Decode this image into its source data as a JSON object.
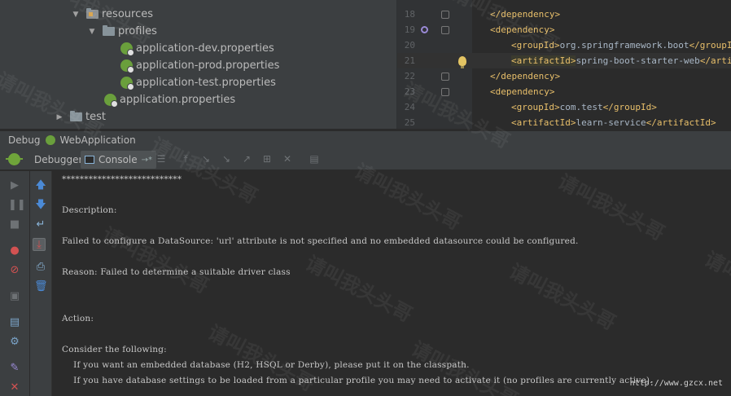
{
  "tree": {
    "items": [
      {
        "label": "resources",
        "arrow": "▼",
        "kind": "resfolder"
      },
      {
        "label": "profiles",
        "arrow": "▼",
        "kind": "folder"
      },
      {
        "label": "application-dev.properties",
        "kind": "spring"
      },
      {
        "label": "application-prod.properties",
        "kind": "spring"
      },
      {
        "label": "application-test.properties",
        "kind": "spring"
      },
      {
        "label": "application.properties",
        "kind": "spring"
      },
      {
        "label": "test",
        "arrow": "▶",
        "kind": "folder"
      }
    ]
  },
  "editor": {
    "lines": [
      {
        "num": "18",
        "text": "</dependency>"
      },
      {
        "num": "19",
        "text": "<dependency>"
      },
      {
        "num": "20",
        "open": "<groupId>",
        "value": "org.springframework.boot",
        "close": "</groupId>"
      },
      {
        "num": "21",
        "open": "<artifactId>",
        "value": "spring-boot-starter-web",
        "close": "</artifact"
      },
      {
        "num": "22",
        "text": "</dependency>"
      },
      {
        "num": "23",
        "text": "<dependency>"
      },
      {
        "num": "24",
        "open": "<groupId>",
        "value": "com.test",
        "close": "</groupId>"
      },
      {
        "num": "25",
        "open": "<artifactId>",
        "value": "learn-service",
        "close": "</artifactId>"
      }
    ]
  },
  "debug": {
    "label": "Debug",
    "config": "WebApplication",
    "tabs": [
      "Debugger",
      "Console"
    ],
    "pin": "→*"
  },
  "console": {
    "lines": [
      "***************************",
      "",
      "Description:",
      "",
      "Failed to configure a DataSource: 'url' attribute is not specified and no embedded datasource could be configured.",
      "",
      "Reason: Failed to determine a suitable driver class",
      "",
      "",
      "Action:",
      "",
      "Consider the following:",
      "    If you want an embedded database (H2, HSQL or Derby), please put it on the classpath.",
      "    If you have database settings to be loaded from a particular profile you may need to activate it (no profiles are currently active)."
    ]
  },
  "watermark": {
    "text": "请叫我头头哥",
    "site": "http://www.gzcx.net"
  },
  "colors": {
    "xml_tag": "#e8bf6a",
    "text": "#a9b7c6",
    "panel": "#3c3f41",
    "background": "#2b2b2b"
  }
}
